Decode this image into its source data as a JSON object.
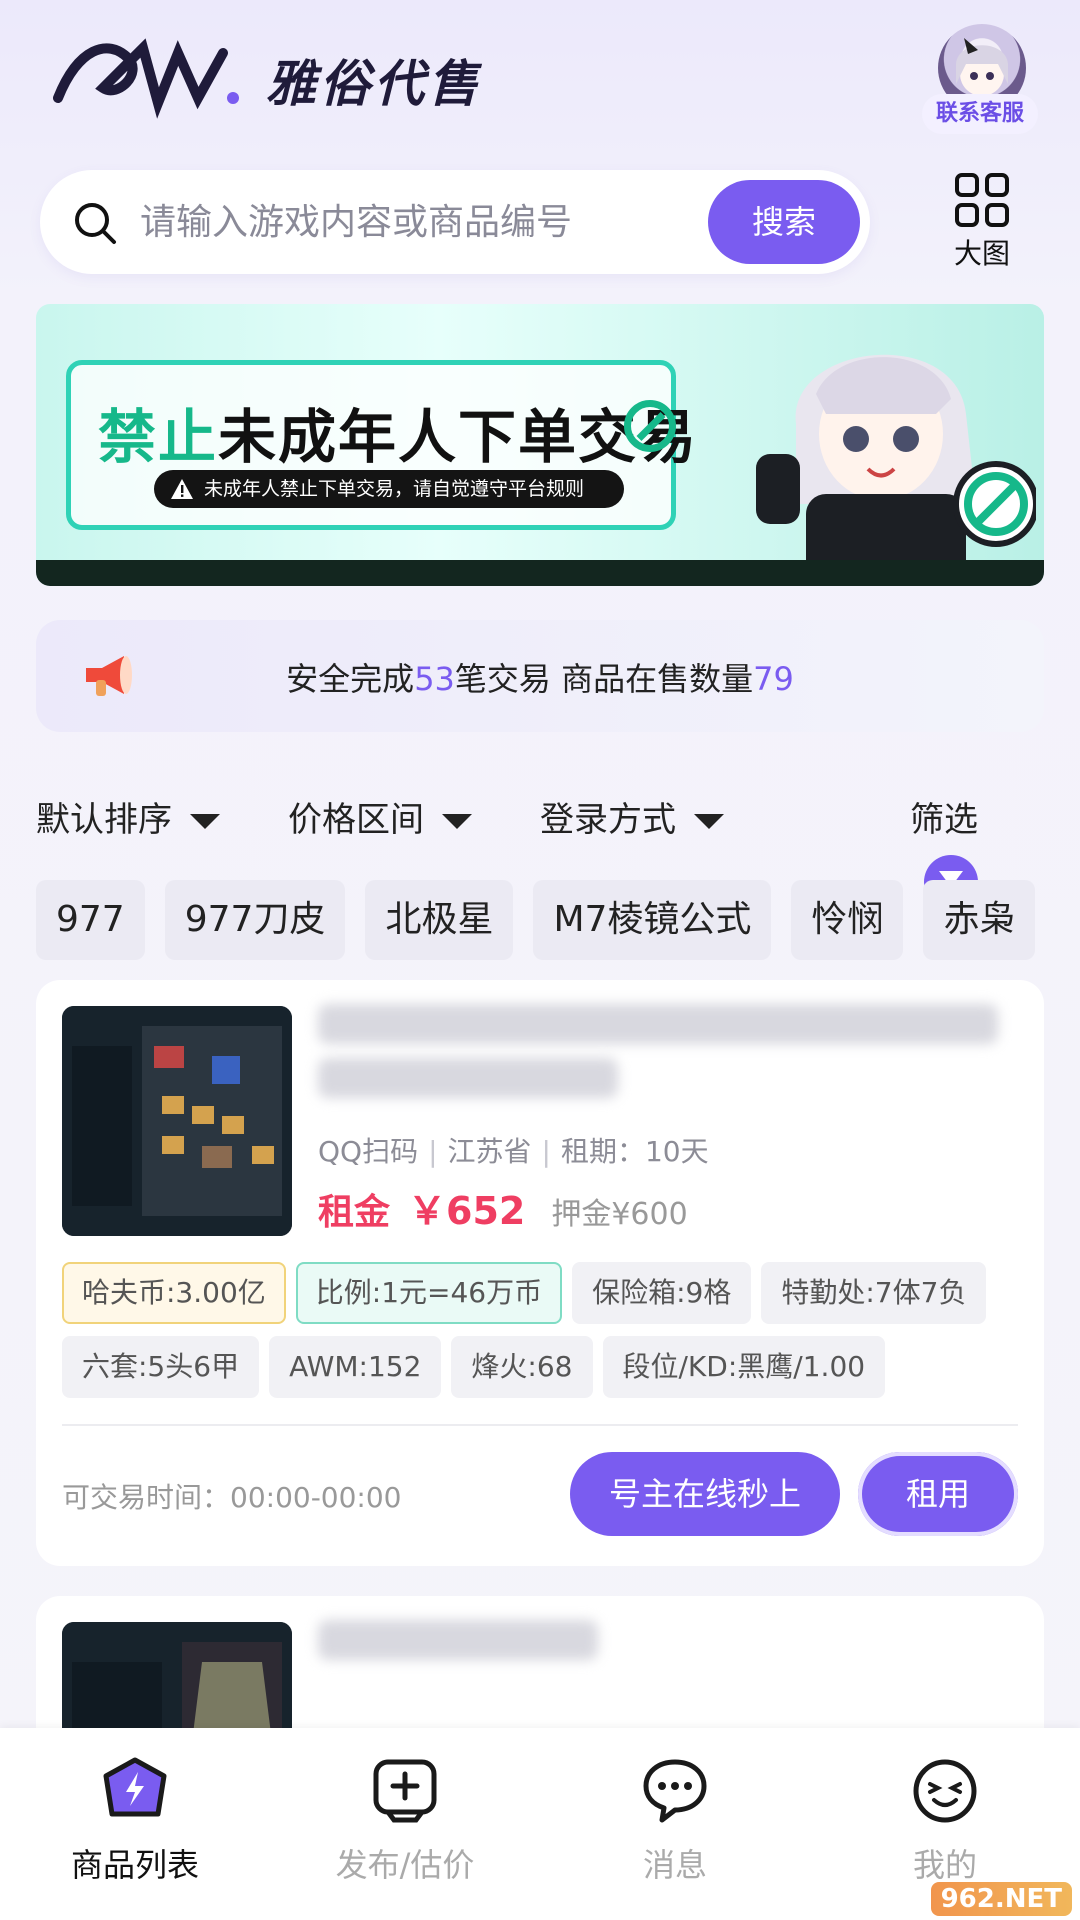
{
  "header": {
    "brand_name": "雅俗代售",
    "logo_text": "雅俗",
    "customer_service_label": "联系客服"
  },
  "search": {
    "placeholder": "请输入游戏内容或商品编号",
    "button_label": "搜索",
    "view_toggle_label": "大图"
  },
  "banner": {
    "title_highlight": "禁止",
    "title_rest": "未成年人下单交易",
    "subtitle": "未成年人禁止下单交易，请自觉遵守平台规则"
  },
  "stats": {
    "prefix": "安全完成",
    "trades": "53",
    "middle": "笔交易 商品在售数量",
    "on_sale": "79"
  },
  "filters": {
    "sort": "默认排序",
    "price": "价格区间",
    "login": "登录方式",
    "filter": "筛选"
  },
  "tags": [
    "977",
    "977刀皮",
    "北极星",
    "M7棱镜公式",
    "怜悯",
    "赤枭"
  ],
  "listing": {
    "meta": [
      "QQ扫码",
      "江苏省",
      "租期：10天"
    ],
    "price_label": "租金",
    "price_value": "￥652",
    "deposit": "押金¥600",
    "attributes": [
      {
        "text": "哈夫币:3.00亿",
        "style": "yellow"
      },
      {
        "text": "比例:1元=46万币",
        "style": "teal"
      },
      {
        "text": "保险箱:9格",
        "style": "plain"
      },
      {
        "text": "特勤处:7体7负",
        "style": "plain"
      },
      {
        "text": "六套:5头6甲",
        "style": "plain"
      },
      {
        "text": "AWM:152",
        "style": "plain"
      },
      {
        "text": "烽火:68",
        "style": "plain"
      },
      {
        "text": "段位/KD:黑鹰/1.00",
        "style": "plain"
      }
    ],
    "trade_time": "可交易时间：00:00-00:00",
    "online_button": "号主在线秒上",
    "rent_button": "租用"
  },
  "nav": {
    "items": [
      {
        "label": "商品列表",
        "icon": "lightning-shield-icon",
        "active": true
      },
      {
        "label": "发布/估价",
        "icon": "gamepad-plus-icon",
        "active": false
      },
      {
        "label": "消息",
        "icon": "chat-bubble-icon",
        "active": false
      },
      {
        "label": "我的",
        "icon": "smiley-icon",
        "active": false
      }
    ]
  },
  "watermark": "962.NET",
  "colors": {
    "accent": "#7a5cf0",
    "price": "#ef3e62",
    "banner_green": "#16b88a"
  }
}
